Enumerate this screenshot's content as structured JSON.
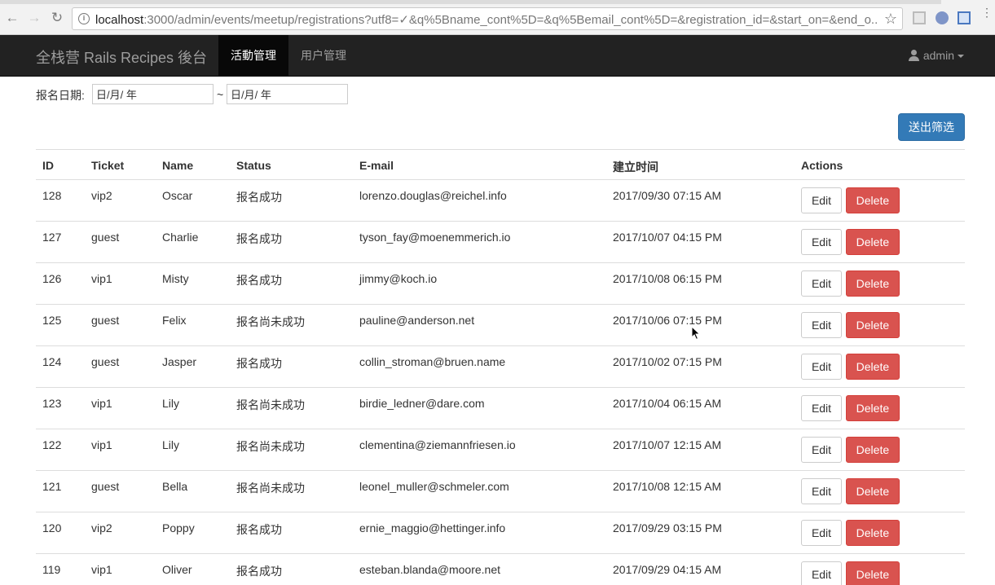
{
  "browser": {
    "url_host": "localhost",
    "url_rest": ":3000/admin/events/meetup/registrations?utf8=✓&q%5Bname_cont%5D=&q%5Bemail_cont%5D=&registration_id=&start_on=&end_o..."
  },
  "navbar": {
    "brand": "全栈营 Rails Recipes 後台",
    "items": [
      {
        "label": "活動管理",
        "active": true
      },
      {
        "label": "用户管理",
        "active": false
      }
    ],
    "user": "admin"
  },
  "filter": {
    "label": "报名日期:",
    "start_placeholder": "日/月/ 年",
    "end_placeholder": "日/月/ 年",
    "separator": "~",
    "submit_label": "送出筛选"
  },
  "table": {
    "headers": [
      "ID",
      "Ticket",
      "Name",
      "Status",
      "E-mail",
      "建立时间",
      "Actions"
    ],
    "edit_label": "Edit",
    "delete_label": "Delete",
    "rows": [
      {
        "id": "128",
        "ticket": "vip2",
        "name": "Oscar",
        "status": "报名成功",
        "email": "lorenzo.douglas@reichel.info",
        "created": "2017/09/30 07:15 AM"
      },
      {
        "id": "127",
        "ticket": "guest",
        "name": "Charlie",
        "status": "报名成功",
        "email": "tyson_fay@moenemmerich.io",
        "created": "2017/10/07 04:15 PM"
      },
      {
        "id": "126",
        "ticket": "vip1",
        "name": "Misty",
        "status": "报名成功",
        "email": "jimmy@koch.io",
        "created": "2017/10/08 06:15 PM"
      },
      {
        "id": "125",
        "ticket": "guest",
        "name": "Felix",
        "status": "报名尚未成功",
        "email": "pauline@anderson.net",
        "created": "2017/10/06 07:15 PM"
      },
      {
        "id": "124",
        "ticket": "guest",
        "name": "Jasper",
        "status": "报名成功",
        "email": "collin_stroman@bruen.name",
        "created": "2017/10/02 07:15 PM"
      },
      {
        "id": "123",
        "ticket": "vip1",
        "name": "Lily",
        "status": "报名尚未成功",
        "email": "birdie_ledner@dare.com",
        "created": "2017/10/04 06:15 AM"
      },
      {
        "id": "122",
        "ticket": "vip1",
        "name": "Lily",
        "status": "报名尚未成功",
        "email": "clementina@ziemannfriesen.io",
        "created": "2017/10/07 12:15 AM"
      },
      {
        "id": "121",
        "ticket": "guest",
        "name": "Bella",
        "status": "报名尚未成功",
        "email": "leonel_muller@schmeler.com",
        "created": "2017/10/08 12:15 AM"
      },
      {
        "id": "120",
        "ticket": "vip2",
        "name": "Poppy",
        "status": "报名成功",
        "email": "ernie_maggio@hettinger.info",
        "created": "2017/09/29 03:15 PM"
      },
      {
        "id": "119",
        "ticket": "vip1",
        "name": "Oliver",
        "status": "报名成功",
        "email": "esteban.blanda@moore.net",
        "created": "2017/09/29 04:15 AM"
      }
    ]
  }
}
